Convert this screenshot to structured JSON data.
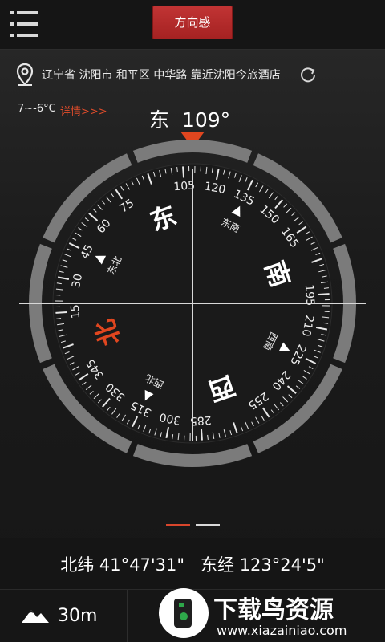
{
  "topbar": {
    "title": "方向感",
    "menu_icon": "menu-icon"
  },
  "location": {
    "text": "辽宁省 沈阳市 和平区 中华路 靠近沈阳今旅酒店",
    "icon": "map-pin-icon",
    "refresh_icon": "refresh-icon"
  },
  "weather": {
    "temp": "7~-6°C",
    "detail_link": "详情>>>"
  },
  "heading": {
    "direction": "东",
    "degrees": "109°",
    "value": 109
  },
  "compass": {
    "numbers": [
      "105",
      "120",
      "135",
      "150",
      "165",
      "195",
      "210",
      "225",
      "240",
      "255",
      "285",
      "300",
      "315",
      "330",
      "345",
      "15",
      "30",
      "45",
      "60",
      "75"
    ],
    "cardinals": {
      "east": "东",
      "south": "南",
      "west": "西",
      "north": "北"
    },
    "intercardinals": {
      "ne": "东北",
      "se": "东南",
      "sw": "西南",
      "nw": "西北"
    },
    "colors": {
      "north": "#e0461f",
      "marker": "#e0461f",
      "text": "#ffffff"
    }
  },
  "pager": {
    "count": 2,
    "active": 0
  },
  "coordinates": {
    "lat": "北纬 41°47'31\"",
    "lon": "东经 123°24'5\""
  },
  "altitude": {
    "value": "30m",
    "icon": "mountain-icon"
  },
  "watermark": {
    "title": "下载鸟资源",
    "url": "www.xiazainiao.com"
  }
}
